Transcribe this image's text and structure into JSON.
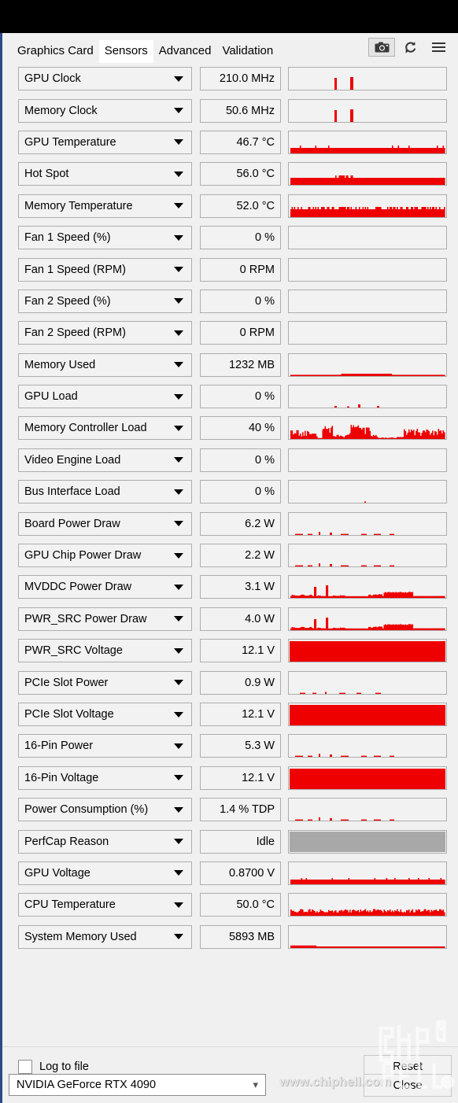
{
  "window": {
    "accent_color": "#2a4a8a",
    "graph_color": "#ee0000",
    "perfcap_color": "#a8a8a8"
  },
  "tabs": [
    {
      "label": "Graphics Card",
      "active": false
    },
    {
      "label": "Sensors",
      "active": true
    },
    {
      "label": "Advanced",
      "active": false
    },
    {
      "label": "Validation",
      "active": false
    }
  ],
  "toolbar": {
    "camera_title": "camera-icon",
    "refresh_title": "refresh-icon",
    "menu_title": "menu-icon"
  },
  "sensors": [
    {
      "name": "GPU Clock",
      "value": "210.0 MHz",
      "graph": "spikes2"
    },
    {
      "name": "Memory Clock",
      "value": "50.6 MHz",
      "graph": "spikes2"
    },
    {
      "name": "GPU Temperature",
      "value": "46.7 °C",
      "graph": "band-low"
    },
    {
      "name": "Hot Spot",
      "value": "56.0 °C",
      "graph": "band-mid"
    },
    {
      "name": "Memory Temperature",
      "value": "52.0 °C",
      "graph": "band-rough"
    },
    {
      "name": "Fan 1 Speed (%)",
      "value": "0 %",
      "graph": "empty"
    },
    {
      "name": "Fan 1 Speed (RPM)",
      "value": "0 RPM",
      "graph": "empty"
    },
    {
      "name": "Fan 2 Speed (%)",
      "value": "0 %",
      "graph": "empty"
    },
    {
      "name": "Fan 2 Speed (RPM)",
      "value": "0 RPM",
      "graph": "empty"
    },
    {
      "name": "Memory Used",
      "value": "1232 MB",
      "graph": "flatline"
    },
    {
      "name": "GPU Load",
      "value": "0 %",
      "graph": "sparse"
    },
    {
      "name": "Memory Controller Load",
      "value": "40 %",
      "graph": "busy"
    },
    {
      "name": "Video Engine Load",
      "value": "0 %",
      "graph": "empty"
    },
    {
      "name": "Bus Interface Load",
      "value": "0 %",
      "graph": "dot"
    },
    {
      "name": "Board Power Draw",
      "value": "6.2 W",
      "graph": "sparse2"
    },
    {
      "name": "GPU Chip Power Draw",
      "value": "2.2 W",
      "graph": "sparse2"
    },
    {
      "name": "MVDDC Power Draw",
      "value": "3.1 W",
      "graph": "power"
    },
    {
      "name": "PWR_SRC Power Draw",
      "value": "4.0 W",
      "graph": "power"
    },
    {
      "name": "PWR_SRC Voltage",
      "value": "12.1 V",
      "graph": "solid"
    },
    {
      "name": "PCIe Slot Power",
      "value": "0.9 W",
      "graph": "sparse3"
    },
    {
      "name": "PCIe Slot Voltage",
      "value": "12.1 V",
      "graph": "solid"
    },
    {
      "name": "16-Pin Power",
      "value": "5.3 W",
      "graph": "sparse2"
    },
    {
      "name": "16-Pin Voltage",
      "value": "12.1 V",
      "graph": "solid"
    },
    {
      "name": "Power Consumption (%)",
      "value": "1.4 % TDP",
      "graph": "sparse2"
    },
    {
      "name": "PerfCap Reason",
      "value": "Idle",
      "graph": "gray"
    },
    {
      "name": "GPU Voltage",
      "value": "0.8700 V",
      "graph": "band-thin"
    },
    {
      "name": "CPU Temperature",
      "value": "50.0 °C",
      "graph": "noisy"
    },
    {
      "name": "System Memory Used",
      "value": "5893 MB",
      "graph": "thinline"
    }
  ],
  "footer": {
    "log_to_file_label": "Log to file",
    "log_to_file_checked": false,
    "gpu_selected": "NVIDIA GeForce RTX 4090",
    "reset_label": "Reset",
    "close_label": "Close"
  },
  "watermark": {
    "text": "www.chiphell.com"
  }
}
